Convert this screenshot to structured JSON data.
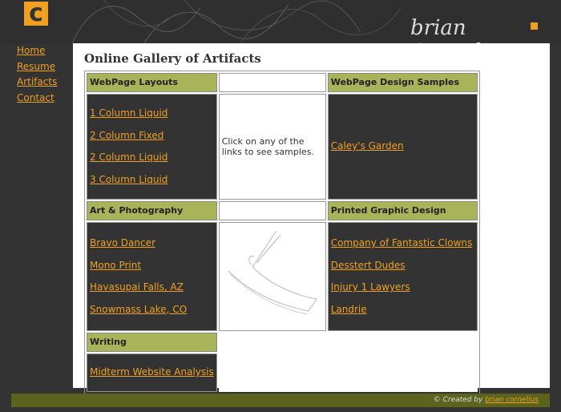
{
  "header": {
    "logo_letter": "c",
    "brand_name": "brian Cornelius"
  },
  "nav": [
    "Home",
    "Resume",
    "Artifacts",
    "Contact"
  ],
  "main": {
    "title": "Online Gallery of Artifacts",
    "sections": {
      "webpage_layouts": {
        "heading": "WebPage Layouts",
        "links": [
          "1 Column Liquid",
          "2 Column Fixed",
          "2 Column Liquid",
          "3 Column Liquid"
        ]
      },
      "note": "Click on any of the links to see samples.",
      "design_samples": {
        "heading": "WebPage Design Samples",
        "links": [
          "Caley's Garden"
        ]
      },
      "art_photo": {
        "heading": "Art & Photography",
        "links": [
          "Bravo Dancer",
          "Mono Print",
          "Havasupai Falls, AZ",
          "Snowmass Lake, CO"
        ]
      },
      "printed": {
        "heading": "Printed Graphic Design",
        "links": [
          "Company of Fantastic Clowns",
          "Desstert Dudes",
          "Injury 1 Lawyers",
          "Landrie"
        ]
      },
      "writing": {
        "heading": "Writing",
        "links": [
          "Midterm Website Analysis"
        ]
      }
    }
  },
  "footer": {
    "prefix": "© Created by",
    "link": "brian cornelius"
  },
  "colors": {
    "accent": "#f0a020",
    "header_green": "#a8b35a",
    "footer_green": "#5c631c",
    "background": "#333333"
  }
}
